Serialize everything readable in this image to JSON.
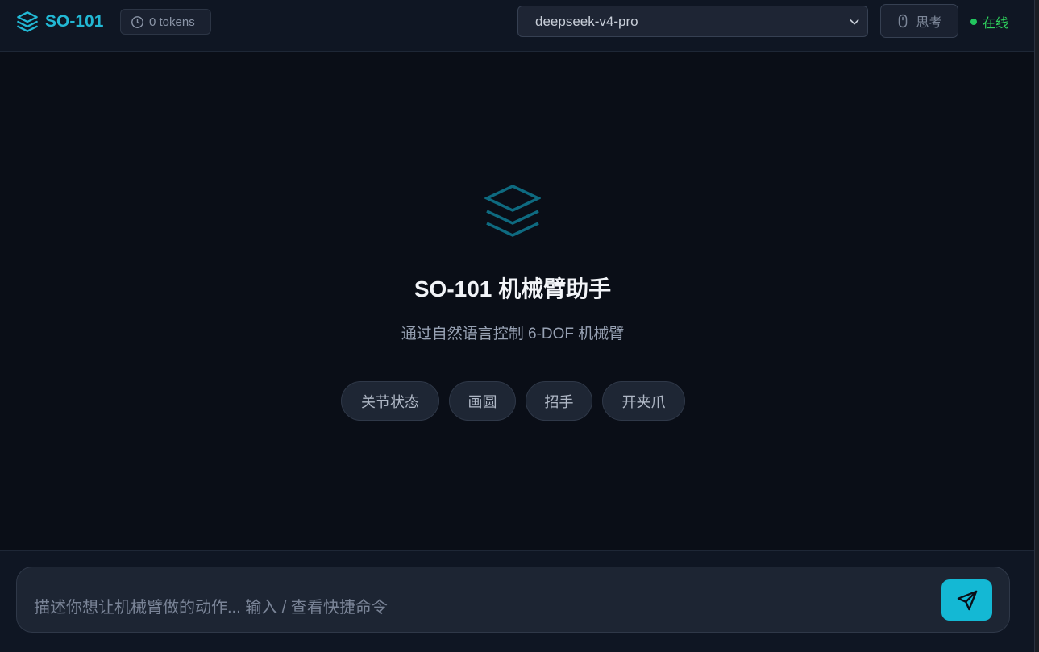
{
  "header": {
    "brand": "SO-101",
    "tokens": "0 tokens",
    "model": "deepseek-v4-pro",
    "think": "思考",
    "status": "在线"
  },
  "hero": {
    "title": "SO-101 机械臂助手",
    "subtitle": "通过自然语言控制 6-DOF 机械臂"
  },
  "quick_actions": [
    "关节状态",
    "画圆",
    "招手",
    "开夹爪"
  ],
  "composer": {
    "placeholder": "描述你想让机械臂做的动作... 输入 / 查看快捷命令",
    "value": ""
  },
  "icons": {
    "brand": "layers-icon",
    "tokens": "clock-icon",
    "model": "chevron-down-icon",
    "think": "mouse-icon",
    "status": "status-dot",
    "hero": "layers-icon",
    "send": "send-icon"
  },
  "colors": {
    "accent": "#14b8d4",
    "online": "#22c55e",
    "background": "#0a0e17"
  }
}
